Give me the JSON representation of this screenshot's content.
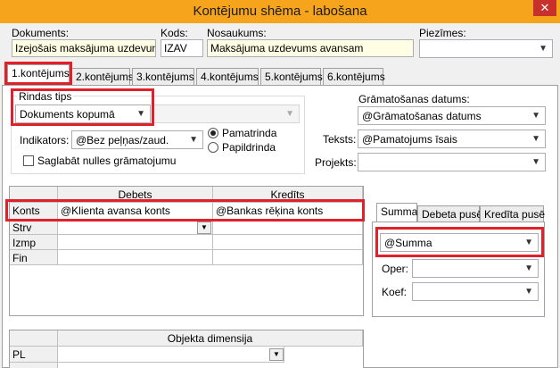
{
  "window": {
    "title": "Kontējumu shēma - labošana",
    "close_glyph": "✕"
  },
  "header": {
    "dokuments_label": "Dokuments:",
    "dokuments_value": "Izejošais maksājuma uzdevum",
    "kods_label": "Kods:",
    "kods_value": "IZAV",
    "nosaukums_label": "Nosaukums:",
    "nosaukums_value": "Maksājuma uzdevums avansam",
    "piezimes_label": "Piezīmes:",
    "piezimes_value": ""
  },
  "tabs": [
    "1.kontējums",
    "2.kontējums",
    "3.kontējums",
    "4.kontējums",
    "5.kontējums",
    "6.kontējums"
  ],
  "left": {
    "rindas_tips_label": "Rindas tips",
    "rindas_tips_value": "Dokuments kopumā",
    "disabled_value": "",
    "indikators_label": "Indikators:",
    "indikators_value": "@Bez peļņas/zaud.",
    "pamatrinda_label": "Pamatrinda",
    "papildrinda_label": "Papildrinda",
    "saglabat_label": "Saglabāt nulles grāmatojumu"
  },
  "right": {
    "gramatosanas_label": "Grāmatošanas datums:",
    "gramatosanas_value": "@Grāmatošanas datums",
    "teksts_label": "Teksts:",
    "teksts_value": "@Pamatojums īsais",
    "projekts_label": "Projekts:",
    "projekts_value": ""
  },
  "grid": {
    "headers": [
      "Debets",
      "Kredīts"
    ],
    "rows": [
      {
        "label": "Konts",
        "debets": "@Klienta avansa konts",
        "kredits": "@Bankas rēķina konts"
      },
      {
        "label": "Strv",
        "debets": "",
        "kredits": ""
      },
      {
        "label": "Izmp",
        "debets": "",
        "kredits": ""
      },
      {
        "label": "Fin",
        "debets": "",
        "kredits": ""
      }
    ]
  },
  "summa_panel": {
    "tabs": [
      "Summa",
      "Debeta pusē",
      "Kredīta pusē"
    ],
    "summa_value": "@Summa",
    "oper_label": "Oper:",
    "oper_value": "",
    "koef_label": "Koef:",
    "koef_value": ""
  },
  "dimension_grid": {
    "header": "Objekta dimensija",
    "rows": [
      {
        "label": "PL",
        "value": ""
      }
    ]
  },
  "colors": {
    "titlebar": "#f6a41c",
    "highlight": "#e0202a",
    "yellow_field": "#fffde3"
  }
}
